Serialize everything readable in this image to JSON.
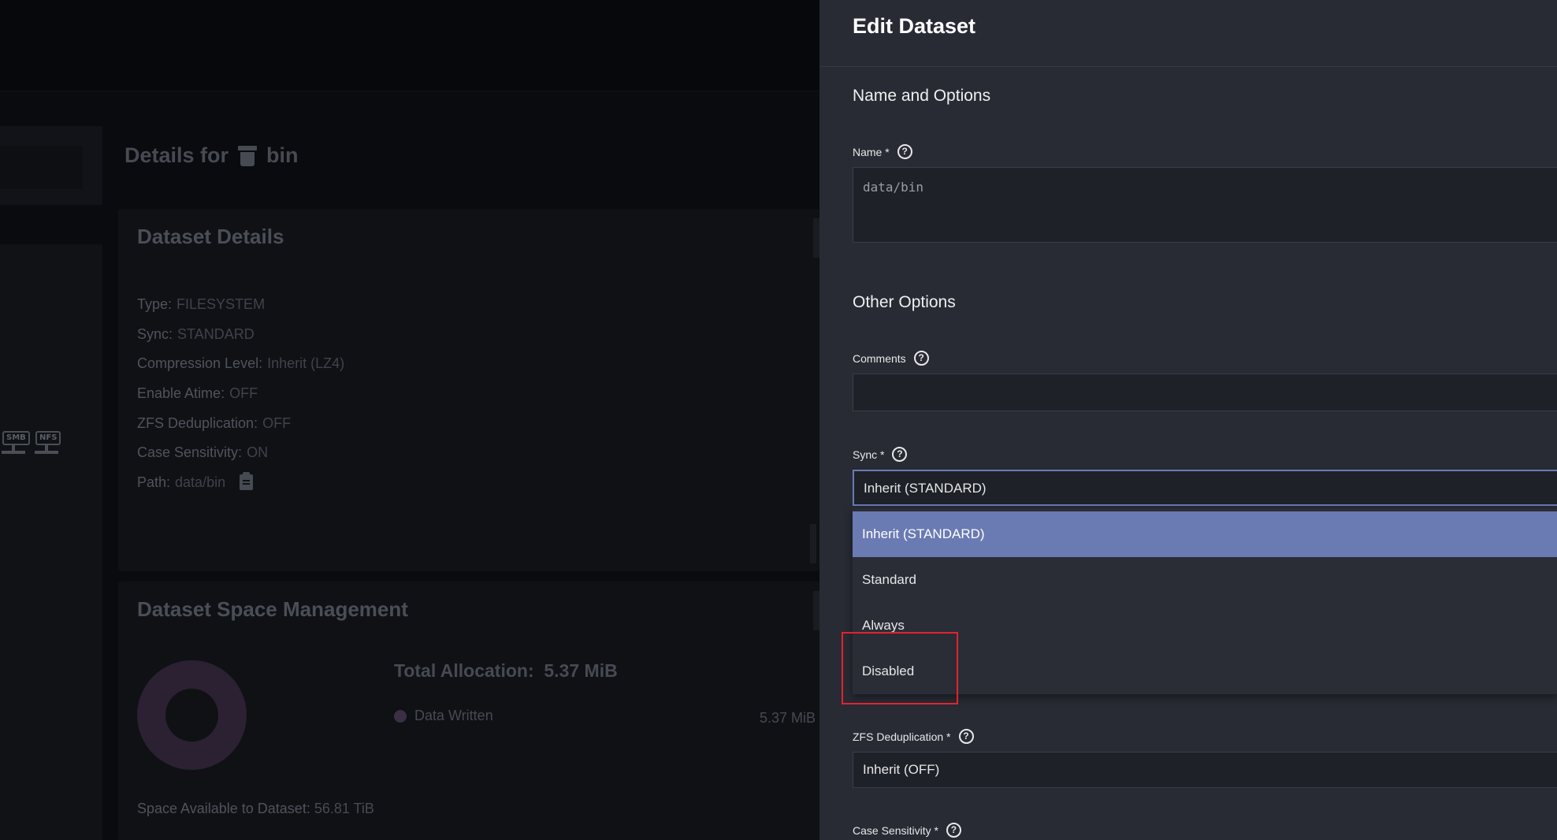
{
  "background": {
    "details_prefix": "Details for",
    "dataset_name": "bin",
    "share_icons": [
      "SMB",
      "NFS"
    ],
    "dataset_details": {
      "title": "Dataset Details",
      "rows": [
        {
          "key": "Type:",
          "value": "FILESYSTEM"
        },
        {
          "key": "Sync:",
          "value": "STANDARD"
        },
        {
          "key": "Compression Level:",
          "value": "Inherit (LZ4)"
        },
        {
          "key": "Enable Atime:",
          "value": "OFF"
        },
        {
          "key": "ZFS Deduplication:",
          "value": "OFF"
        },
        {
          "key": "Case Sensitivity:",
          "value": "ON"
        },
        {
          "key": "Path:",
          "value": "data/bin"
        }
      ]
    },
    "space_management": {
      "title": "Dataset Space Management",
      "total_allocation_label": "Total Allocation:",
      "total_allocation_value": "5.37 MiB",
      "legend_label": "Data Written",
      "legend_value": "5.37 MiB",
      "space_available_label": "Space Available to Dataset:",
      "space_available_value": "56.81 TiB"
    }
  },
  "panel": {
    "title": "Edit Dataset",
    "section_name": "Name and Options",
    "name_label": "Name *",
    "name_value": "data/bin",
    "section_other": "Other Options",
    "comments_label": "Comments",
    "comments_value": "",
    "sync_label": "Sync *",
    "sync_value": "Inherit (STANDARD)",
    "sync_options": [
      "Inherit (STANDARD)",
      "Standard",
      "Always",
      "Disabled"
    ],
    "dedup_label": "ZFS Deduplication *",
    "dedup_value": "Inherit (OFF)",
    "case_label": "Case Sensitivity *",
    "help_glyph": "?"
  },
  "colors": {
    "panel_bg": "#282b34",
    "selected_option": "#6a7ab3",
    "highlight": "#e0242e"
  }
}
